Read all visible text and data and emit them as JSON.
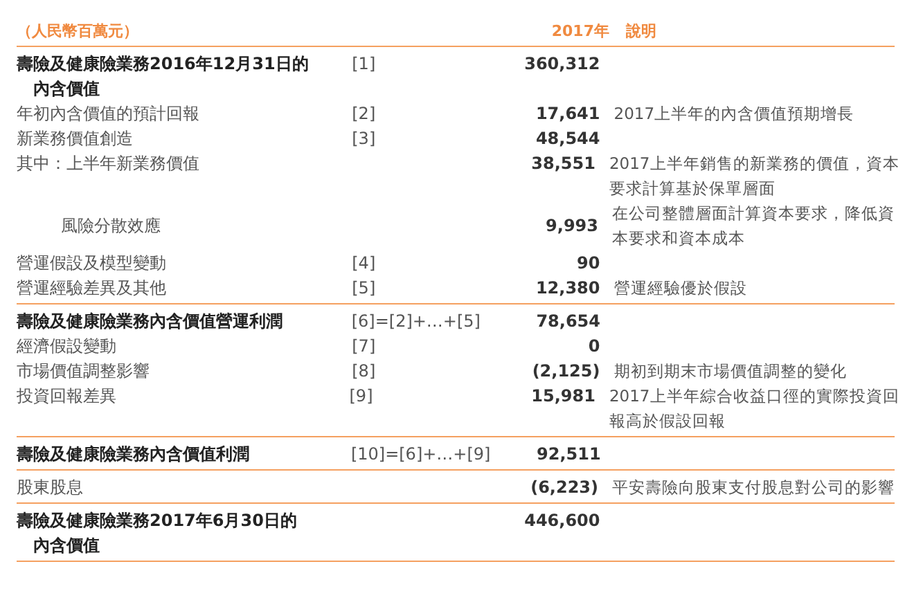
{
  "header": {
    "unit": "（人民幣百萬元）",
    "year": "2017年",
    "note": "說明"
  },
  "rows": [
    {
      "kind": "total",
      "label": [
        "壽險及健康險業務2016年12月31日的",
        "內含價值"
      ],
      "ref": "[1]",
      "value": "360,312",
      "note": [],
      "rule_below": false
    },
    {
      "kind": "item",
      "label": [
        "年初內含價值的預計回報"
      ],
      "ref": "[2]",
      "value": "17,641",
      "note": [
        "2017上半年的內含價值預期增長"
      ],
      "rule_below": false
    },
    {
      "kind": "item",
      "label": [
        "新業務價值創造"
      ],
      "ref": "[3]",
      "value": "48,544",
      "note": [],
      "rule_below": false
    },
    {
      "kind": "item",
      "label": [
        "其中：上半年新業務價值"
      ],
      "value": "38,551",
      "note": [
        "2017上半年銷售的新業務的價值，資本",
        "要求計算基於保單層面"
      ],
      "rule_below": false
    },
    {
      "kind": "sub",
      "label": [
        "風險分散效應"
      ],
      "value": "9,993",
      "note": [
        "在公司整體層面計算資本要求，降低資",
        "本要求和資本成本"
      ],
      "rule_below": false
    },
    {
      "kind": "item",
      "label": [
        "營運假設及模型變動"
      ],
      "ref": "[4]",
      "value": "90",
      "note": [],
      "rule_below": false
    },
    {
      "kind": "item",
      "label": [
        "營運經驗差異及其他"
      ],
      "ref": "[5]",
      "value": "12,380",
      "note": [
        "營運經驗優於假設"
      ],
      "rule_below": true
    },
    {
      "kind": "total",
      "label": [
        "壽險及健康險業務內含價值營運利潤"
      ],
      "ref": "[6]=[2]+…+[5]",
      "value": "78,654",
      "note": [],
      "rule_below": false
    },
    {
      "kind": "item",
      "label": [
        "經濟假設變動"
      ],
      "ref": "[7]",
      "value": "0",
      "note": [],
      "rule_below": false
    },
    {
      "kind": "item",
      "label": [
        "市場價值調整影響"
      ],
      "ref": "[8]",
      "value": "(2,125)",
      "note": [
        "期初到期末市場價值調整的變化"
      ],
      "rule_below": false
    },
    {
      "kind": "item",
      "label": [
        "投資回報差異"
      ],
      "ref": "[9]",
      "value": "15,981",
      "note": [
        "2017上半年綜合收益口徑的實際投資回",
        "報高於假設回報"
      ],
      "rule_below": true
    },
    {
      "kind": "total",
      "label": [
        "壽險及健康險業務內含價值利潤"
      ],
      "ref": "[10]=[6]+…+[9]",
      "value": "92,511",
      "note": [],
      "rule_below": true
    },
    {
      "kind": "item",
      "label": [
        "股東股息"
      ],
      "value": "(6,223)",
      "note": [
        "平安壽險向股東支付股息對公司的影響"
      ],
      "rule_below": true
    },
    {
      "kind": "total",
      "label": [
        "壽險及健康險業務2017年6月30日的",
        "內含價值"
      ],
      "value": "446,600",
      "note": [],
      "rule_below": true
    }
  ]
}
